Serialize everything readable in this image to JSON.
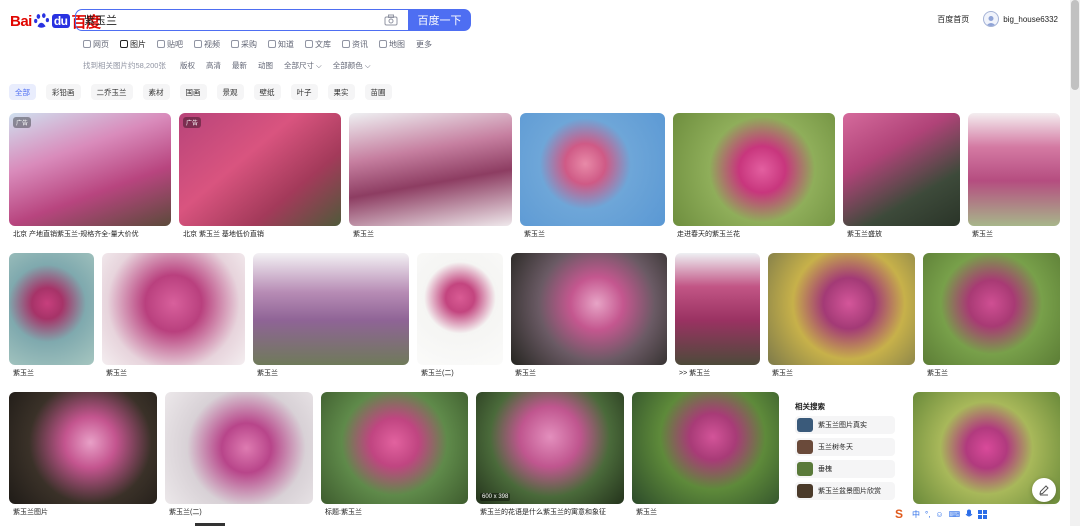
{
  "logo": {
    "bai": "Bai",
    "du": "du",
    "cn": "百度"
  },
  "search": {
    "value": "紫玉兰",
    "button": "百度一下"
  },
  "header": {
    "home": "百度首页",
    "username": "big_house6332"
  },
  "tabs": [
    {
      "label": "网页",
      "icon": "web-icon"
    },
    {
      "label": "图片",
      "icon": "image-icon"
    },
    {
      "label": "贴吧",
      "icon": "tieba-icon"
    },
    {
      "label": "视频",
      "icon": "video-icon"
    },
    {
      "label": "采购",
      "icon": "purchase-icon"
    },
    {
      "label": "知道",
      "icon": "zhidao-icon"
    },
    {
      "label": "文库",
      "icon": "wenku-icon"
    },
    {
      "label": "资讯",
      "icon": "news-icon"
    },
    {
      "label": "地图",
      "icon": "map-icon"
    },
    {
      "label": "更多",
      "icon": ""
    }
  ],
  "filters": {
    "count": "找到相关图片约58,200张",
    "items": [
      "版权",
      "高清",
      "最新",
      "动图",
      "全部尺寸 ⌵",
      "全部颜色 ⌵"
    ]
  },
  "chips": [
    "全部",
    "彩铅画",
    "二乔玉兰",
    "素材",
    "国画",
    "景观",
    "壁纸",
    "叶子",
    "果实",
    "苗圃"
  ],
  "row1": [
    {
      "cap": "北京 产地直销紫玉兰-规格齐全-量大价优",
      "ad": "广告"
    },
    {
      "cap": "北京 紫玉兰 基地低价直销",
      "ad": "广告"
    },
    {
      "cap": "紫玉兰",
      "ad": ""
    },
    {
      "cap": "紫玉兰",
      "ad": ""
    },
    {
      "cap": "走进春天的紫玉兰花",
      "ad": ""
    },
    {
      "cap": "紫玉兰盛放",
      "ad": ""
    },
    {
      "cap": "紫玉兰",
      "ad": ""
    }
  ],
  "row2": [
    {
      "cap": "紫玉兰"
    },
    {
      "cap": "紫玉兰"
    },
    {
      "cap": "紫玉兰"
    },
    {
      "cap": "紫玉兰(二)"
    },
    {
      "cap": "紫玉兰"
    },
    {
      "cap": ">> 紫玉兰"
    },
    {
      "cap": "紫玉兰"
    },
    {
      "cap": "紫玉兰"
    }
  ],
  "row3": [
    {
      "cap": "紫玉兰图片"
    },
    {
      "cap": "紫玉兰(二)"
    },
    {
      "cap": "标题:紫玉兰"
    },
    {
      "cap": "紫玉兰的花语是什么紫玉兰的寓意和象征",
      "size": "600 x 398"
    },
    {
      "cap": "紫玉兰"
    },
    {
      "cap": ""
    }
  ],
  "related": {
    "title": "相关搜索",
    "items": [
      "紫玉兰图片真实",
      "玉兰树冬天",
      "垂槐",
      "紫玉兰盆景图片欣赏"
    ]
  },
  "ime": {
    "logo": "S",
    "lang": "中",
    "items": [
      "°,",
      "☺",
      "⌨"
    ]
  },
  "colors": {
    "accent": "#4e6ef2",
    "brand_red": "#e10601",
    "brand_blue": "#2932e1"
  }
}
